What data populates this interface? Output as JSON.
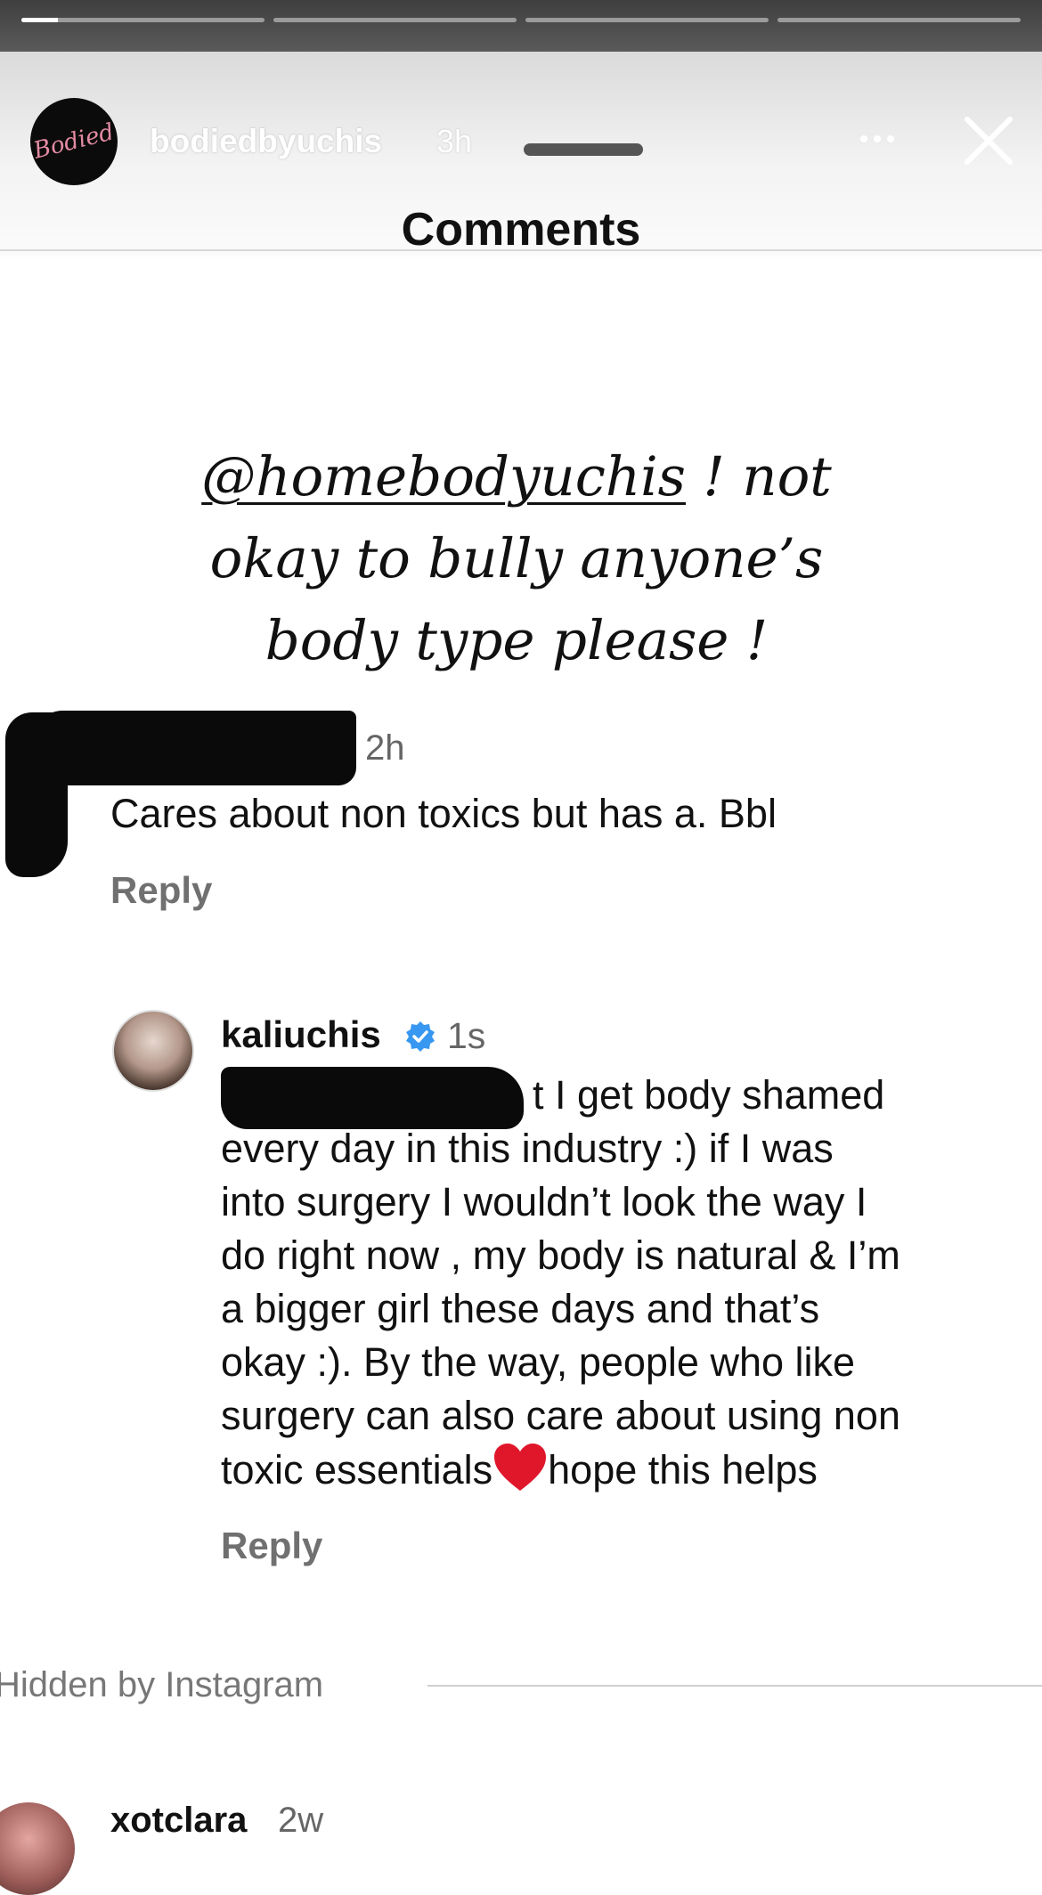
{
  "story": {
    "progress": [
      0.15,
      0,
      0,
      0
    ],
    "username": "bodiedbyuchis",
    "time": "3h",
    "avatar_text": "Bodied"
  },
  "sheet": {
    "title": "Comments"
  },
  "overlay": {
    "mention": "@homebodyuchis",
    "line1_rest": " ! not",
    "line2": "okay to bully anyone’s",
    "line3": "body type please !"
  },
  "comments": [
    {
      "time": "2h",
      "text": "Cares about non toxics but has a. Bbl",
      "reply_label": "Reply"
    },
    {
      "username": "kaliuchis",
      "time": "1s",
      "lines": [
        "t I get body shamed",
        "every day in this industry :) if I was",
        "into surgery I wouldn’t look the way I",
        "do right now , my body is natural & I’m",
        "a bigger girl these days and that’s",
        "okay :).  By the way, people who like",
        "surgery can also care about using non"
      ],
      "last_line_before_heart": "toxic essentials",
      "last_line_after_heart": "hope this helps",
      "reply_label": "Reply"
    }
  ],
  "hidden": {
    "label": "Hidden by Instagram"
  },
  "next_comment": {
    "username": "xotclara",
    "time": "2w"
  },
  "colors": {
    "verified": "#3897f0",
    "heart": "#e0162b"
  }
}
